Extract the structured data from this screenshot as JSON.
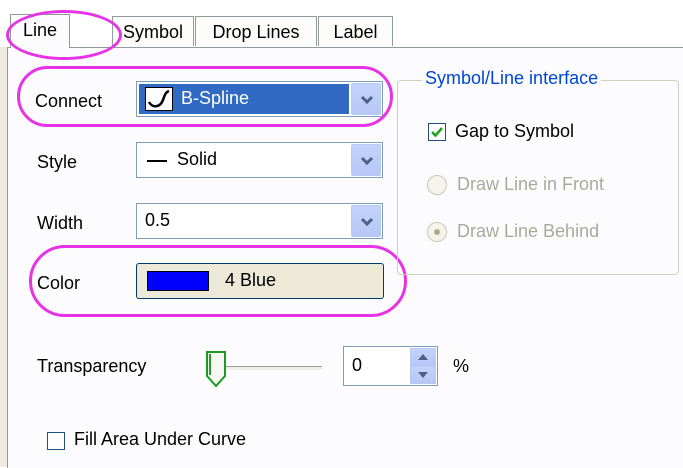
{
  "tabs": [
    {
      "label": "Line",
      "active": true
    },
    {
      "label": "Symbol",
      "active": false
    },
    {
      "label": "Drop Lines",
      "active": false
    },
    {
      "label": "Label",
      "active": false
    }
  ],
  "connect": {
    "label": "Connect",
    "value": "B-Spline",
    "icon": "bspline-curve-icon"
  },
  "style": {
    "label": "Style",
    "value": "Solid"
  },
  "width": {
    "label": "Width",
    "value": "0.5"
  },
  "color": {
    "label": "Color",
    "value": "4 Blue",
    "swatch": "#0000ff"
  },
  "symbol_line_group": {
    "title": "Symbol/Line interface",
    "gap_to_symbol": {
      "label": "Gap to Symbol",
      "checked": true
    },
    "draw_line_front": {
      "label": "Draw Line in Front",
      "selected": false,
      "enabled": false
    },
    "draw_line_behind": {
      "label": "Draw Line Behind",
      "selected": true,
      "enabled": false
    }
  },
  "transparency": {
    "label": "Transparency",
    "value": "0",
    "unit": "%",
    "level": 0
  },
  "fill_area": {
    "label": "Fill Area Under Curve",
    "checked": false
  },
  "colors": {
    "highlight_oval": "#e633e6",
    "group_title": "#0046d5",
    "selection": "#316ac5"
  }
}
